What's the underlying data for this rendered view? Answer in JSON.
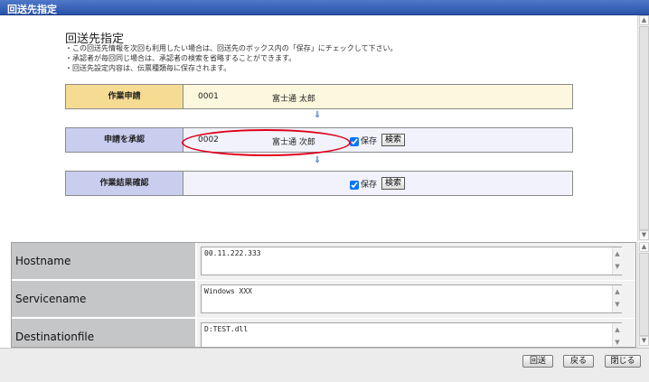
{
  "window": {
    "title": "回送先指定"
  },
  "main": {
    "heading": "回送先指定",
    "notes": [
      "・この回送先情報を次回も利用したい場合は、回送先のボックス内の「保存」にチェックして下さい。",
      "・承認者が毎回同じ場合は、承認者の検索を省略することができます。",
      "・回送先設定内容は、伝票種類毎に保存されます。"
    ],
    "routes": [
      {
        "label": "作業申請",
        "code": "0001",
        "name": "富士通 太郎",
        "has_save": false
      },
      {
        "label": "申請を承認",
        "code": "0002",
        "name": "富士通 次郎",
        "has_save": true,
        "save_label": "保存",
        "search_label": "検索",
        "save_checked": true
      },
      {
        "label": "作業結果確認",
        "code": "",
        "name": "",
        "has_save": true,
        "save_label": "保存",
        "search_label": "検索",
        "save_checked": true
      }
    ],
    "highlight_color": "#e0001a",
    "arrow_icon": "double-chevron-down-icon"
  },
  "form": {
    "fields": [
      {
        "label": "Hostname",
        "value": "00.11.222.333"
      },
      {
        "label": "Servicename",
        "value": "Windows XXX"
      },
      {
        "label": "Destinationfile",
        "value": "D:TEST.dll"
      }
    ]
  },
  "footer": {
    "send_label": "回送",
    "back_label": "戻る",
    "close_label": "閉じる"
  },
  "colors": {
    "titlebar": "#2852a8",
    "step_first_label": "#f6dc93",
    "step_label": "#c9cdee",
    "form_label_bg": "#c5c6c8"
  }
}
